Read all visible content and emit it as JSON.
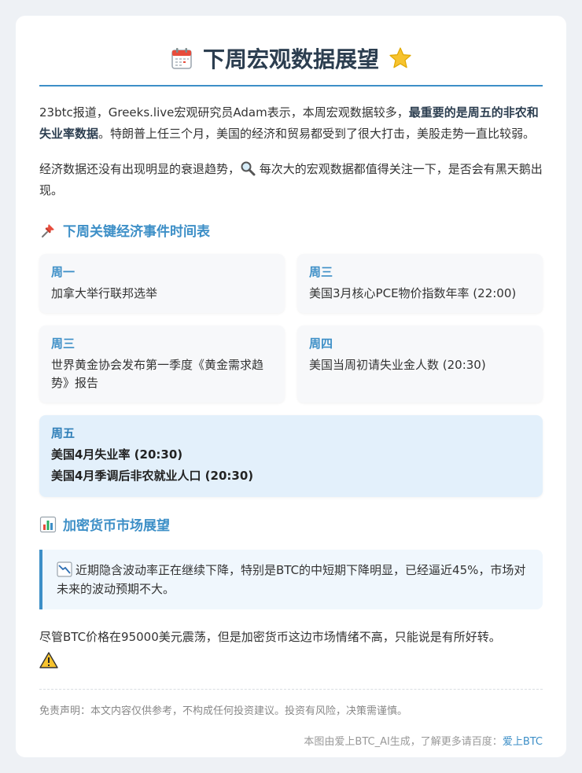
{
  "title": "下周宏观数据展望",
  "intro": {
    "p1_prefix": "23btc报道，Greeks.live宏观研究员Adam表示，本周宏观数据较多，",
    "p1_bold": "最重要的是周五的非农和失业率数据",
    "p1_suffix": "。特朗普上任三个月，美国的经济和贸易都受到了很大打击，美股走势一直比较弱。",
    "p2_before": "经济数据还没有出现明显的衰退趋势，",
    "p2_after": " 每次大的宏观数据都值得关注一下，是否会有黑天鹅出现。"
  },
  "schedule": {
    "heading": "下周关键经济事件时间表",
    "events": [
      {
        "day": "周一",
        "text": "加拿大举行联邦选举"
      },
      {
        "day": "周三",
        "text": "美国3月核心PCE物价指数年率 (22:00)"
      },
      {
        "day": "周三",
        "text": "世界黄金协会发布第一季度《黄金需求趋势》报告"
      },
      {
        "day": "周四",
        "text": "美国当周初请失业金人数 (20:30)"
      }
    ],
    "friday": {
      "day": "周五",
      "line1": "美国4月失业率 (20:30)",
      "line2": "美国4月季调后非农就业人口 (20:30)"
    }
  },
  "crypto": {
    "heading": "加密货币市场展望",
    "quote": "近期隐含波动率正在继续下降，特别是BTC的中短期下降明显，已经逼近45%，市场对未来的波动预期不大。",
    "closing": "尽管BTC价格在95000美元震荡，但是加密货币这边市场情绪不高，只能说是有所好转。"
  },
  "disclaimer": "免责声明：本文内容仅供参考，不构成任何投资建议。投资有风险，决策需谨慎。",
  "footer": {
    "prefix": "本图由爱上BTC_AI生成，了解更多请百度：",
    "link": "爱上BTC"
  },
  "colors": {
    "accent": "#3d8fc7",
    "friday_bg": "#e3f0fb",
    "quote_bg": "#f0f7fd"
  },
  "icons": [
    "calendar-icon",
    "star-icon",
    "magnifier-icon",
    "pushpin-icon",
    "bar-chart-icon",
    "chart-decreasing-icon",
    "warning-icon"
  ]
}
